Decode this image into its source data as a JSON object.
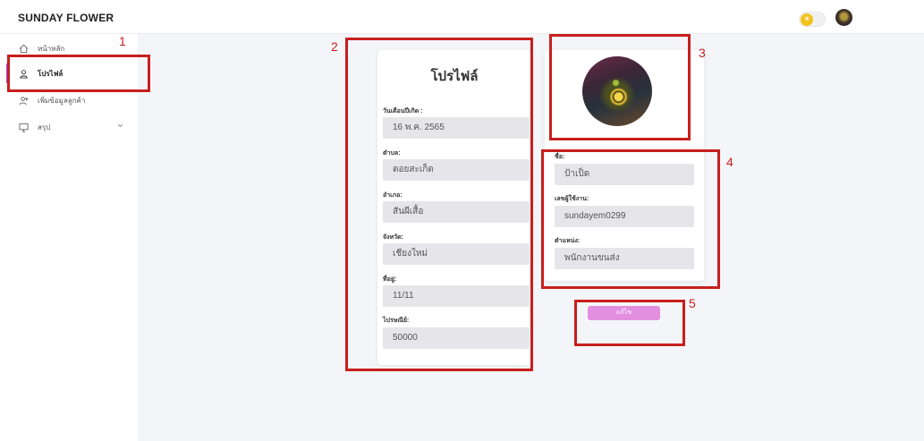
{
  "brand": "SUNDAY FLOWER",
  "sidebar": {
    "items": [
      {
        "label": "หน้าหลัก",
        "icon": "home-icon"
      },
      {
        "label": "โปรไฟล์",
        "icon": "user-icon",
        "active": true
      },
      {
        "label": "เพิ่มข้อมูลลูกค้า",
        "icon": "user-add-icon"
      },
      {
        "label": "สรุป",
        "icon": "monitor-icon",
        "has_submenu": true
      }
    ]
  },
  "profile_card": {
    "title": "โปรไฟล์",
    "fields": [
      {
        "label": "วันเดือนปีเกิด :",
        "value": "16 พ.ค. 2565"
      },
      {
        "label": "ตำบล:",
        "value": "ดอยสะเก็ด"
      },
      {
        "label": "อำเภอ:",
        "value": "สันผีเสื้อ"
      },
      {
        "label": "จังหวัด:",
        "value": "เชียงใหม่"
      },
      {
        "label": "ที่อยู่:",
        "value": "11/11"
      },
      {
        "label": "ไปรษณีย์:",
        "value": "50000"
      }
    ]
  },
  "info_card": {
    "fields": [
      {
        "label": "ชื่อ:",
        "value": "ป้าเป็ด"
      },
      {
        "label": "เลขผู้ใช้งาน:",
        "value": "sundayem0299"
      },
      {
        "label": "ตำแหน่ง:",
        "value": "พนักงานขนส่ง"
      }
    ]
  },
  "edit_button": {
    "label": "แก้ไข"
  },
  "annotations": [
    "1",
    "2",
    "3",
    "4",
    "5"
  ],
  "colors": {
    "accent": "#a54be8",
    "annotation": "#c81e1e",
    "edit_button": "#e38fe0",
    "toggle_knob": "#f2c21b",
    "main_bg": "#f4f5f9",
    "field_bg": "#e6e6ea"
  }
}
